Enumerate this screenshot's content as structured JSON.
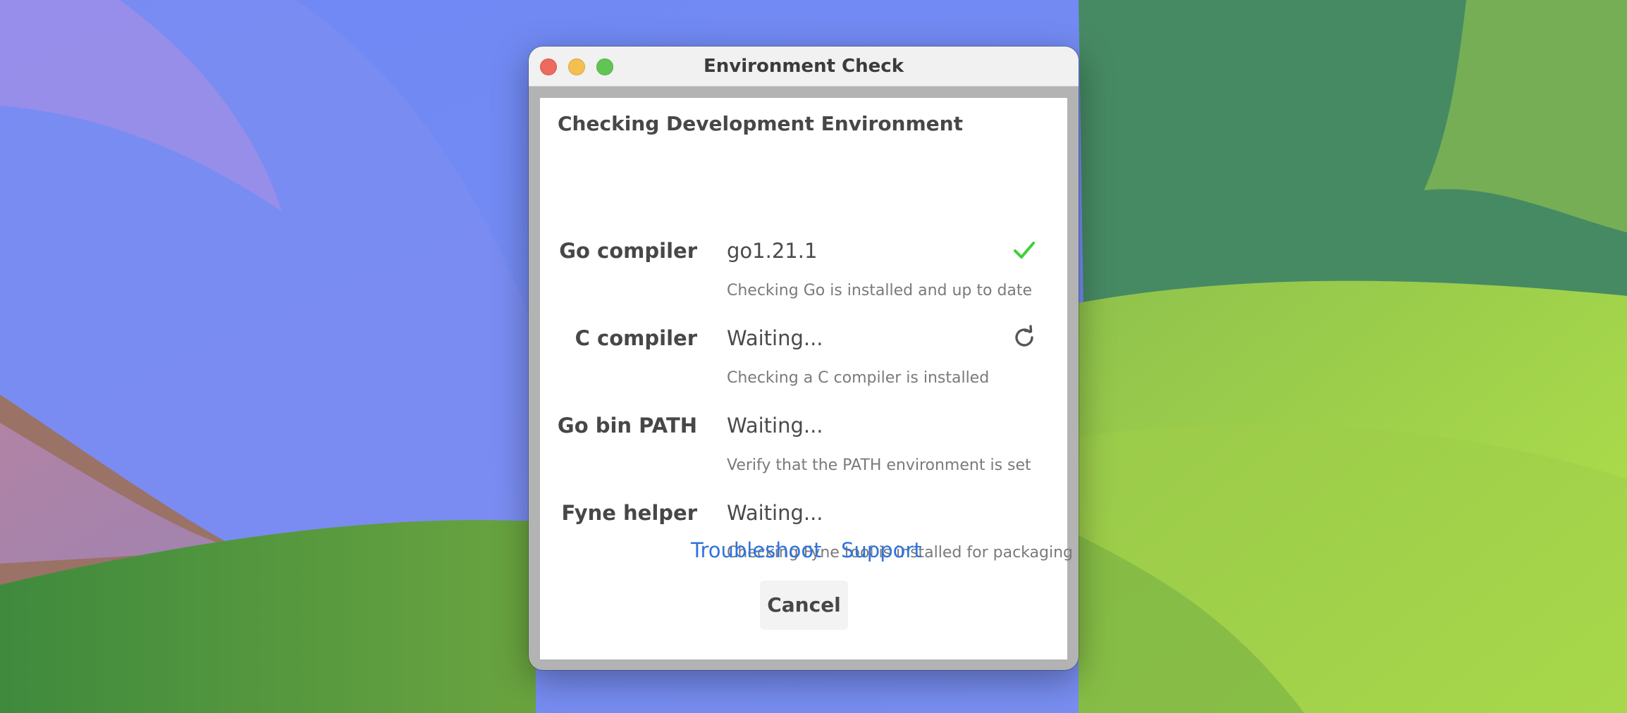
{
  "window": {
    "title": "Environment Check"
  },
  "dialog": {
    "heading": "Checking Development Environment",
    "checks": [
      {
        "label": "Go compiler",
        "value": "go1.21.1",
        "description": "Checking Go is installed and up to date",
        "status_icon": "checkmark-icon",
        "status_color": "#3bd13b"
      },
      {
        "label": "C compiler",
        "value": "Waiting...",
        "description": "Checking a C compiler is installed",
        "status_icon": "refresh-icon",
        "status_color": "#555555"
      },
      {
        "label": "Go bin PATH",
        "value": "Waiting...",
        "description": "Verify that the PATH environment is set",
        "status_icon": null
      },
      {
        "label": "Fyne helper",
        "value": "Waiting...",
        "description": "Checking Fyne tool is installed for packaging",
        "status_icon": null
      }
    ],
    "links": {
      "troubleshoot": "Troubleshoot",
      "support": "Support"
    },
    "cancel_label": "Cancel"
  },
  "colors": {
    "link": "#2f74e0",
    "traffic_close": "#ec6a5e",
    "traffic_minimize": "#f4bf4f",
    "traffic_zoom": "#61c554"
  }
}
